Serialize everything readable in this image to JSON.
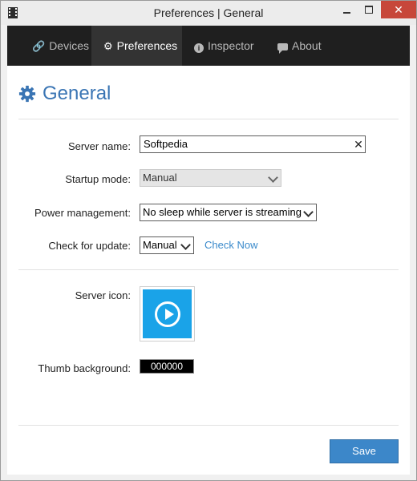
{
  "window": {
    "title": "Preferences | General",
    "close_glyph": "✕"
  },
  "tabs": [
    {
      "label": "Devices",
      "icon": "link-icon",
      "glyph": "🔗",
      "active": false
    },
    {
      "label": "Preferences",
      "icon": "gear-icon",
      "glyph": "⚙",
      "active": true
    },
    {
      "label": "Inspector",
      "icon": "info-icon",
      "glyph": "i",
      "active": false
    },
    {
      "label": "About",
      "icon": "comment-icon",
      "active": false
    }
  ],
  "page": {
    "heading": "General",
    "heading_icon": "gear-icon",
    "accent_color": "#3a75b4"
  },
  "form": {
    "server_name": {
      "label": "Server name:",
      "value": "Softpedia",
      "clear_glyph": "✕"
    },
    "startup_mode": {
      "label": "Startup mode:",
      "value": "Manual",
      "disabled": true
    },
    "power_management": {
      "label": "Power management:",
      "value": "No sleep while server is streaming"
    },
    "check_for_update": {
      "label": "Check for update:",
      "value": "Manual",
      "link": "Check Now"
    },
    "server_icon": {
      "label": "Server icon:",
      "tile_color": "#1aa3e8",
      "icon": "play-icon"
    },
    "thumb_background": {
      "label": "Thumb background:",
      "value": "000000"
    }
  },
  "footer": {
    "save_label": "Save",
    "save_color": "#3c87c9"
  }
}
